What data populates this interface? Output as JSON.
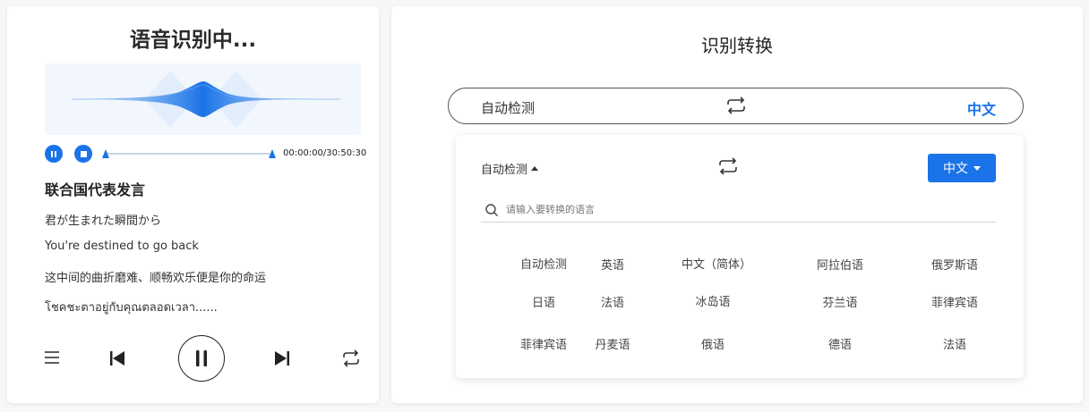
{
  "left_panel": {
    "title": "语音识别中...",
    "time_readout": "00:00:00/30:50:30",
    "transcript": {
      "title": "联合国代表发言",
      "lines": [
        "君が生まれた瞬間から",
        "You're destined to go back",
        "这中间的曲折磨难、顺畅欢乐便是你的命运",
        "โชคชะตาอยู่กับคุณตลอดเวลา......"
      ]
    },
    "controls": {
      "playlist_icon": "list-icon",
      "prev_icon": "skip-previous-icon",
      "pause_icon": "pause-icon",
      "next_icon": "skip-next-icon",
      "repeat_icon": "repeat-icon"
    }
  },
  "right_panel": {
    "title": "识别转换",
    "lang_bar": {
      "source": "自动检测",
      "target": "中文",
      "swap_icon": "swap-icon"
    },
    "dropdown": {
      "source": "自动检测",
      "target_button": "中文",
      "search_placeholder": "请输入要转换的语言",
      "languages": [
        [
          "自动检测",
          "英语",
          "中文（简体）",
          "阿拉伯语",
          "俄罗斯语"
        ],
        [
          "日语",
          "法语",
          "冰岛语",
          "芬兰语",
          "菲律宾语"
        ],
        [
          "菲律宾语",
          "丹麦语",
          "俄语",
          "德语",
          "法语"
        ]
      ]
    }
  },
  "colors": {
    "accent": "#1a73e8",
    "wave_bg": "#f2f7fd"
  }
}
